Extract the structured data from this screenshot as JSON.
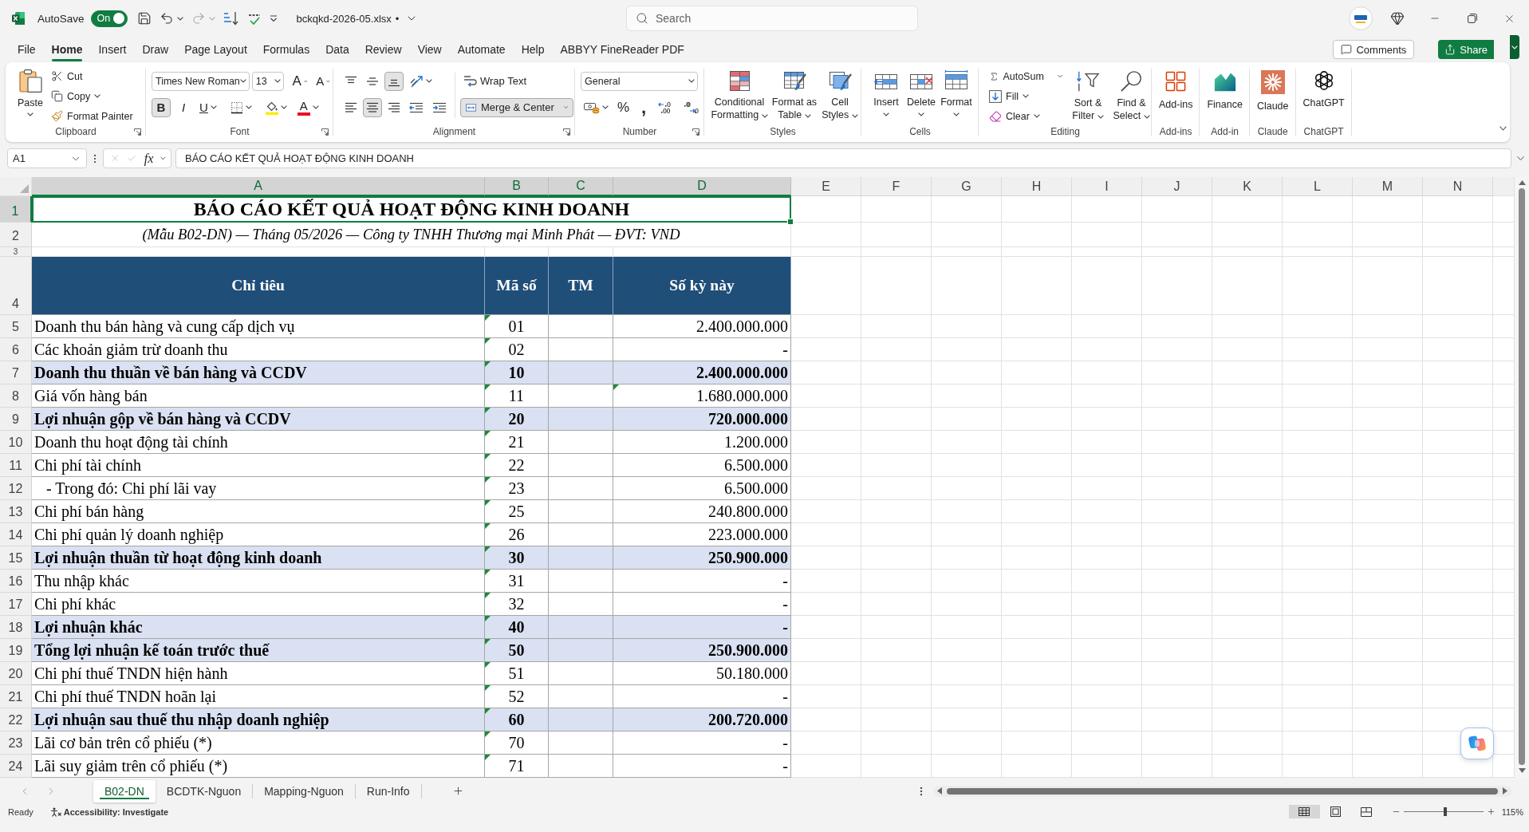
{
  "title_bar": {
    "autosave": {
      "label": "AutoSave",
      "toggle_text": "On",
      "on": true
    },
    "file_name": "bckqkd-2026-05.xlsx",
    "unsaved_mark": "•",
    "search": {
      "placeholder": "Search"
    }
  },
  "menu_tabs": [
    {
      "label": "File",
      "selected": false
    },
    {
      "label": "Home",
      "selected": true
    },
    {
      "label": "Insert",
      "selected": false
    },
    {
      "label": "Draw",
      "selected": false
    },
    {
      "label": "Page Layout",
      "selected": false
    },
    {
      "label": "Formulas",
      "selected": false
    },
    {
      "label": "Data",
      "selected": false
    },
    {
      "label": "Review",
      "selected": false
    },
    {
      "label": "View",
      "selected": false
    },
    {
      "label": "Automate",
      "selected": false
    },
    {
      "label": "Help",
      "selected": false
    },
    {
      "label": "ABBYY FineReader PDF",
      "selected": false
    }
  ],
  "header_buttons": {
    "comments": "Comments",
    "share": "Share"
  },
  "ribbon": {
    "groups": [
      {
        "kind": "clipboard",
        "label": "Clipboard",
        "launcher": true,
        "paste": "Paste",
        "cut": "Cut",
        "copy": "Copy",
        "format_painter": "Format Painter"
      },
      {
        "kind": "font",
        "label": "Font",
        "launcher": true,
        "font_name": "Times New Roman",
        "font_size": "13",
        "grow": "A",
        "shrink": "A",
        "toggles": [
          {
            "label": "B",
            "selected": true
          },
          {
            "label": "I",
            "selected": false
          },
          {
            "label": "U",
            "selected": false
          }
        ],
        "font_color": "A"
      },
      {
        "kind": "alignment",
        "label": "Alignment",
        "launcher": true,
        "vertical": [
          {
            "selected": false
          },
          {
            "selected": false
          },
          {
            "selected": true
          }
        ],
        "horizontal": [
          {
            "selected": false
          },
          {
            "selected": true
          },
          {
            "selected": false
          }
        ],
        "wrap_text": {
          "label": "Wrap Text",
          "selected": false
        },
        "merge": {
          "label": "Merge & Center",
          "selected": true
        }
      },
      {
        "kind": "number",
        "label": "Number",
        "launcher": true,
        "format": "General",
        "percent": "%",
        "comma": ","
      },
      {
        "kind": "styles",
        "label": "Styles",
        "launcher": false,
        "buttons": [
          "Conditional Formatting",
          "Format as Table",
          "Cell Styles"
        ]
      },
      {
        "kind": "cells",
        "label": "Cells",
        "launcher": false,
        "buttons": [
          "Insert",
          "Delete",
          "Format"
        ]
      },
      {
        "kind": "editing",
        "label": "Editing",
        "launcher": false,
        "small": [
          "AutoSum",
          "Fill",
          "Clear"
        ],
        "large": [
          "Sort & Filter",
          "Find & Select"
        ]
      },
      {
        "kind": "addin",
        "label": "Add-ins",
        "launcher": false,
        "button": "Add-ins"
      },
      {
        "kind": "addin",
        "label": "Add-in",
        "launcher": false,
        "button": "Finance"
      },
      {
        "kind": "addin",
        "label": "Claude",
        "launcher": false,
        "button": "Claude"
      },
      {
        "kind": "addin",
        "label": "ChatGPT",
        "launcher": false,
        "button": "ChatGPT"
      }
    ]
  },
  "formula_bar": {
    "name_box": "A1",
    "function_label": "fx",
    "formula": "BÁO CÁO KẾT QUẢ HOẠT ĐỘNG KINH DOANH"
  },
  "sheet": {
    "columns": [
      {
        "letter": "A",
        "selected": true
      },
      {
        "letter": "B",
        "selected": true
      },
      {
        "letter": "C",
        "selected": true
      },
      {
        "letter": "D",
        "selected": true
      },
      {
        "letter": "E",
        "selected": false
      },
      {
        "letter": "F",
        "selected": false
      },
      {
        "letter": "G",
        "selected": false
      },
      {
        "letter": "H",
        "selected": false
      },
      {
        "letter": "I",
        "selected": false
      },
      {
        "letter": "J",
        "selected": false
      },
      {
        "letter": "K",
        "selected": false
      },
      {
        "letter": "L",
        "selected": false
      },
      {
        "letter": "M",
        "selected": false
      },
      {
        "letter": "N",
        "selected": false
      }
    ],
    "rows": [
      {
        "kind": "title",
        "number": "1",
        "selected": true,
        "text": "BÁO CÁO KẾT QUẢ HOẠT ĐỘNG KINH DOANH"
      },
      {
        "kind": "subtitle",
        "number": "2",
        "selected": false,
        "text": "(Mẫu B02-DN) — Tháng 05/2026 — Công ty TNHH Thương mại Minh Phát — ĐVT: VND"
      },
      {
        "kind": "blank",
        "number": "3",
        "selected": false
      },
      {
        "kind": "header",
        "number": "4",
        "selected": false,
        "cells": [
          "Chỉ tiêu",
          "Mã số",
          "TM",
          "Số kỳ này"
        ]
      },
      {
        "kind": "item",
        "number": "5",
        "selected": false,
        "subtotal": false,
        "label": "Doanh thu bán hàng và cung cấp dịch vụ",
        "code": "01",
        "code_flag": true,
        "amount": "2.400.000.000",
        "amount_flag": false
      },
      {
        "kind": "item",
        "number": "6",
        "selected": false,
        "subtotal": false,
        "label": "Các khoản giảm trừ doanh thu",
        "code": "02",
        "code_flag": true,
        "amount": "-",
        "amount_flag": false
      },
      {
        "kind": "item",
        "number": "7",
        "selected": false,
        "subtotal": true,
        "label": "Doanh thu thuần về bán hàng và CCDV",
        "code": "10",
        "code_flag": true,
        "amount": "2.400.000.000",
        "amount_flag": false
      },
      {
        "kind": "item",
        "number": "8",
        "selected": false,
        "subtotal": false,
        "label": "Giá vốn hàng bán",
        "code": "11",
        "code_flag": true,
        "amount": "1.680.000.000",
        "amount_flag": true
      },
      {
        "kind": "item",
        "number": "9",
        "selected": false,
        "subtotal": true,
        "label": "Lợi nhuận gộp về bán hàng và CCDV",
        "code": "20",
        "code_flag": true,
        "amount": "720.000.000",
        "amount_flag": false
      },
      {
        "kind": "item",
        "number": "10",
        "selected": false,
        "subtotal": false,
        "label": "Doanh thu hoạt động tài chính",
        "code": "21",
        "code_flag": true,
        "amount": "1.200.000",
        "amount_flag": false
      },
      {
        "kind": "item",
        "number": "11",
        "selected": false,
        "subtotal": false,
        "label": "Chi phí tài chính",
        "code": "22",
        "code_flag": true,
        "amount": "6.500.000",
        "amount_flag": false
      },
      {
        "kind": "item",
        "number": "12",
        "selected": false,
        "subtotal": false,
        "label": "   - Trong đó: Chi phí lãi vay",
        "code": "23",
        "code_flag": true,
        "amount": "6.500.000",
        "amount_flag": false
      },
      {
        "kind": "item",
        "number": "13",
        "selected": false,
        "subtotal": false,
        "label": "Chi phí bán hàng",
        "code": "25",
        "code_flag": true,
        "amount": "240.800.000",
        "amount_flag": false
      },
      {
        "kind": "item",
        "number": "14",
        "selected": false,
        "subtotal": false,
        "label": "Chi phí quản lý doanh nghiệp",
        "code": "26",
        "code_flag": true,
        "amount": "223.000.000",
        "amount_flag": false
      },
      {
        "kind": "item",
        "number": "15",
        "selected": false,
        "subtotal": true,
        "label": "Lợi nhuận thuần từ hoạt động kinh doanh",
        "code": "30",
        "code_flag": true,
        "amount": "250.900.000",
        "amount_flag": false
      },
      {
        "kind": "item",
        "number": "16",
        "selected": false,
        "subtotal": false,
        "label": "Thu nhập khác",
        "code": "31",
        "code_flag": true,
        "amount": "-",
        "amount_flag": false
      },
      {
        "kind": "item",
        "number": "17",
        "selected": false,
        "subtotal": false,
        "label": "Chi phí khác",
        "code": "32",
        "code_flag": true,
        "amount": "-",
        "amount_flag": false
      },
      {
        "kind": "item",
        "number": "18",
        "selected": false,
        "subtotal": true,
        "label": "Lợi nhuận khác",
        "code": "40",
        "code_flag": true,
        "amount": "-",
        "amount_flag": false
      },
      {
        "kind": "item",
        "number": "19",
        "selected": false,
        "subtotal": true,
        "label": "Tổng lợi nhuận kế toán trước thuế",
        "code": "50",
        "code_flag": true,
        "amount": "250.900.000",
        "amount_flag": false
      },
      {
        "kind": "item",
        "number": "20",
        "selected": false,
        "subtotal": false,
        "label": "Chi phí thuế TNDN hiện hành",
        "code": "51",
        "code_flag": true,
        "amount": "50.180.000",
        "amount_flag": false
      },
      {
        "kind": "item",
        "number": "21",
        "selected": false,
        "subtotal": false,
        "label": "Chi phí thuế TNDN hoãn lại",
        "code": "52",
        "code_flag": true,
        "amount": "-",
        "amount_flag": false
      },
      {
        "kind": "item",
        "number": "22",
        "selected": false,
        "subtotal": true,
        "label": "Lợi nhuận sau thuế thu nhập doanh nghiệp",
        "code": "60",
        "code_flag": true,
        "amount": "200.720.000",
        "amount_flag": false
      },
      {
        "kind": "item",
        "number": "23",
        "selected": false,
        "subtotal": false,
        "label": "Lãi cơ bản trên cổ phiếu (*)",
        "code": "70",
        "code_flag": true,
        "amount": "-",
        "amount_flag": false
      },
      {
        "kind": "item",
        "number": "24",
        "selected": false,
        "subtotal": false,
        "label": "Lãi suy giảm trên cổ phiếu (*)",
        "code": "71",
        "code_flag": true,
        "amount": "-",
        "amount_flag": false
      }
    ]
  },
  "sheet_tabs": [
    {
      "label": "B02-DN",
      "selected": true
    },
    {
      "label": "BCDTK-Nguon",
      "selected": false
    },
    {
      "label": "Mapping-Nguon",
      "selected": false
    },
    {
      "label": "Run-Info",
      "selected": false
    }
  ],
  "status_bar": {
    "ready": "Ready",
    "accessibility": "Accessibility: Investigate",
    "views": [
      {
        "selected": true
      },
      {
        "selected": false
      },
      {
        "selected": false
      }
    ],
    "zoom": {
      "level": 0.52,
      "reading": "115%"
    }
  }
}
